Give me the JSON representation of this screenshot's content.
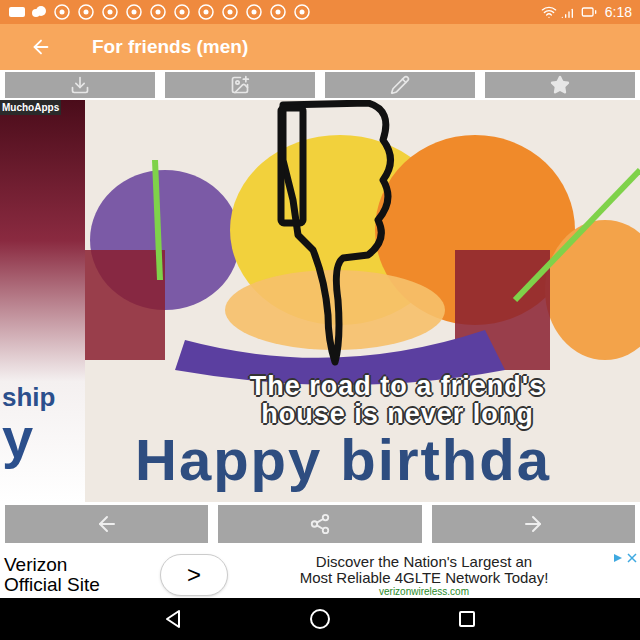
{
  "status_bar": {
    "time": "6:18"
  },
  "app_bar": {
    "title": "For friends (men)"
  },
  "left_card": {
    "watermark": "MuchoApps",
    "lines": [
      "ship",
      "y"
    ]
  },
  "card": {
    "quote_lines": [
      "The road to a friend's",
      "house is never long"
    ],
    "greeting": "Happy birthda"
  },
  "ad": {
    "brand_lines": [
      "Verizon",
      "Official Site"
    ],
    "cta": ">",
    "headline_lines": [
      "Discover the Nation's Largest an",
      "Most Reliable 4GLTE Network Today!"
    ],
    "url": "verizonwireless.com"
  }
}
